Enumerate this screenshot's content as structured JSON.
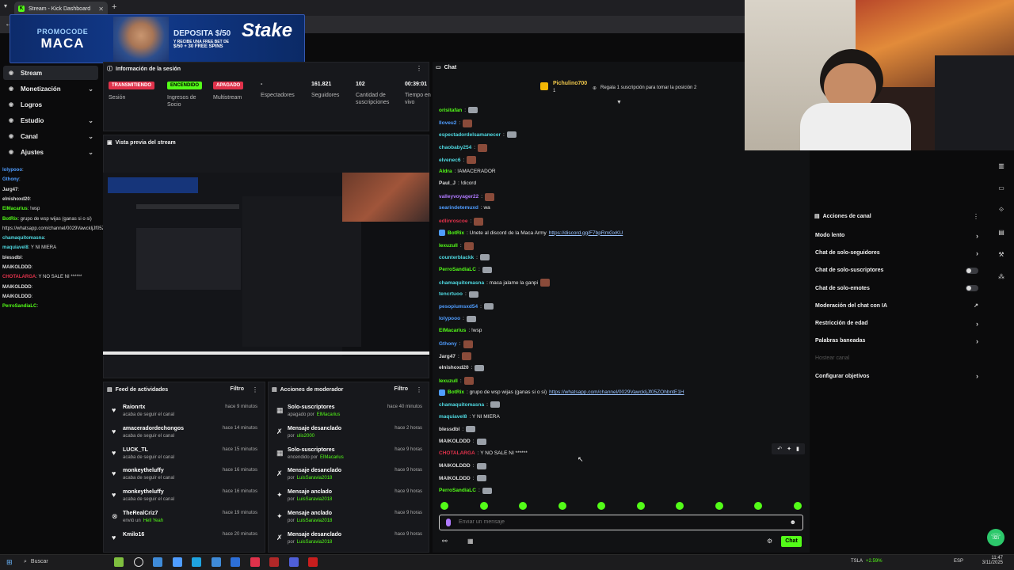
{
  "browser": {
    "tab_title": "Stream - Kick Dashboard"
  },
  "promo": {
    "line1": "PROMOCODE",
    "line2": "MACA",
    "deposit": "DEPOSITA $/50",
    "deposit_sub1": "Y RECIBE UNA FREE BET DE",
    "deposit_sub2": "$/50 + 30 FREE SPINS",
    "brand": "Stake"
  },
  "nav": {
    "items": [
      {
        "label": "Stream",
        "icon": "radio-icon"
      },
      {
        "label": "Monetización",
        "icon": "grid-icon"
      },
      {
        "label": "Logros",
        "icon": "trophy-icon"
      },
      {
        "label": "Estudio",
        "icon": "camera-icon"
      },
      {
        "label": "Canal",
        "icon": "display-icon"
      },
      {
        "label": "Ajustes",
        "icon": "gear-icon"
      }
    ]
  },
  "minichat": [
    {
      "user": "lolypooo",
      "text": ":",
      "color": "#4f9dff"
    },
    {
      "user": "Gthony",
      "text": ":",
      "color": "#4f9dff"
    },
    {
      "user": "Jarg47",
      "text": ":",
      "color": "#dddddd"
    },
    {
      "user": "elnishoxd20",
      "text": ":",
      "color": "#dddddd"
    },
    {
      "user": "ElMacarius",
      "text": ": !wsp",
      "color": "#53fc18"
    },
    {
      "user": "BotRix",
      "text": ": grupo de wsp wijas (ganas si o si)",
      "color": "#53fc18"
    },
    {
      "user": "",
      "text": "https://whatsapp.com/channel/0029VawckljJf05ZOhbntE1H",
      "color": "#dddddd"
    },
    {
      "user": "chamaquitomasna",
      "text": ":",
      "color": "#4fd8e0"
    },
    {
      "user": "maquiavel8",
      "text": ": Y NI MIERA",
      "color": "#4fd8e0"
    },
    {
      "user": "blessdbl",
      "text": ":",
      "color": "#dddddd"
    },
    {
      "user": "MAIKOLDDD",
      "text": ":",
      "color": "#dddddd"
    },
    {
      "user": "CHOTALARGA",
      "text": ": Y NO SALE NI ******",
      "color": "#e0324b"
    },
    {
      "user": "MAIKOLDDD",
      "text": ":",
      "color": "#dddddd"
    },
    {
      "user": "MAIKOLDDD",
      "text": ":",
      "color": "#dddddd"
    },
    {
      "user": "PerroSandiaLC",
      "text": ":",
      "color": "#53fc18"
    }
  ],
  "session": {
    "title": "Información de la sesión",
    "stats": [
      {
        "value": "TRANSMITIENDO",
        "label": "Sesión",
        "pill": "#e0324b"
      },
      {
        "value": "ENCENDIDO",
        "label": "Ingresos de Socio",
        "pill": "#53fc18"
      },
      {
        "value": "APAGADO",
        "label": "Multistream",
        "pill": "#e0324b"
      },
      {
        "value": "-",
        "label": "Espectadores"
      },
      {
        "value": "161.821",
        "label": "Seguidores"
      },
      {
        "value": "102",
        "label": "Cantidad de suscripciones"
      },
      {
        "value": "00:39:01",
        "label": "Tiempo en vivo"
      }
    ]
  },
  "preview": {
    "title": "Vista previa del stream"
  },
  "feed": {
    "title": "Feed de actividades",
    "filter": "Filtro",
    "items": [
      {
        "name": "Raionrtx",
        "sub": "acaba de seguir el canal",
        "time": "hace 9 minutos",
        "icon": "heart-icon"
      },
      {
        "name": "amaceradordechongos",
        "sub": "acaba de seguir el canal",
        "time": "hace 14 minutos",
        "icon": "heart-icon"
      },
      {
        "name": "LUCK_TL",
        "sub": "acaba de seguir el canal",
        "time": "hace 15 minutos",
        "icon": "heart-icon"
      },
      {
        "name": "monkeytheluffy",
        "sub": "acaba de seguir el canal",
        "time": "hace 16 minutos",
        "icon": "heart-icon"
      },
      {
        "name": "monkeytheluffy",
        "sub": "acaba de seguir el canal",
        "time": "hace 16 minutos",
        "icon": "heart-icon"
      },
      {
        "name": "TheRealCriz7",
        "sub": "envió un",
        "sub_hl": "Hell Yeah",
        "time": "hace 19 minutos",
        "icon": "kick-icon"
      },
      {
        "name": "Kmilo16",
        "sub": "",
        "time": "hace 20 minutos",
        "icon": "heart-icon"
      }
    ]
  },
  "mod": {
    "title": "Acciones de moderador",
    "filter": "Filtro",
    "items": [
      {
        "name": "Solo-suscriptores",
        "sub": "apagado por",
        "sub_hl": "ElMacarius",
        "time": "hace 40 minutos",
        "icon": "grid-icon"
      },
      {
        "name": "Mensaje desanclado",
        "sub": "por",
        "sub_hl": "ulis2000",
        "time": "hace 2 horas",
        "icon": "unpin-icon"
      },
      {
        "name": "Solo-suscriptores",
        "sub": "encendido por",
        "sub_hl": "ElMacarius",
        "time": "hace 9 horas",
        "icon": "grid-icon"
      },
      {
        "name": "Mensaje desanclado",
        "sub": "por",
        "sub_hl": "LuisSaravia2018",
        "time": "hace 9 horas",
        "icon": "unpin-icon"
      },
      {
        "name": "Mensaje anclado",
        "sub": "por",
        "sub_hl": "LuisSaravia2018",
        "time": "hace 9 horas",
        "icon": "pin-icon"
      },
      {
        "name": "Mensaje anclado",
        "sub": "por",
        "sub_hl": "LuisSaravia2018",
        "time": "hace 9 horas",
        "icon": "pin-icon"
      },
      {
        "name": "Mensaje desanclado",
        "sub": "por",
        "sub_hl": "LuisSaravia2018",
        "time": "hace 9 horas",
        "icon": "unpin-icon"
      }
    ]
  },
  "chat": {
    "title": "Chat",
    "top_user": "Pichulino700",
    "top_user_sub": "1",
    "gift_text": "Regala 1 suscripción para tomar la posición 2",
    "messages": [
      {
        "user": "orisitafan",
        "text": ":",
        "color": "#53fc18",
        "emote": "gray"
      },
      {
        "user": "lloveu2",
        "text": ":",
        "color": "#4f9dff",
        "emote": "red"
      },
      {
        "user": "espectadordelsamanecer",
        "text": ":",
        "color": "#4fd8e0",
        "emote": "gray"
      },
      {
        "user": "chaobaby254",
        "text": ":",
        "color": "#4fd8e0",
        "emote": "red"
      },
      {
        "user": "elvenec6",
        "text": ":",
        "color": "#4fd8e0",
        "emote": "red"
      },
      {
        "user": "Aldra",
        "text": ": !AMACERADOR",
        "color": "#53fc18"
      },
      {
        "user": "Paul_J",
        "text": ": !dicord",
        "color": "#dddddd"
      },
      {
        "user": "valleyvoyager22",
        "text": ":",
        "color": "#b07aff",
        "emote": "red"
      },
      {
        "user": "searindetemuxd",
        "text": ": wa",
        "color": "#4f9dff"
      },
      {
        "user": "edlinroscoe",
        "text": ":",
        "color": "#e0324b",
        "emote": "red"
      },
      {
        "user": "BotRix",
        "text": ": Unete al discord de la Maca Army",
        "link": "https://discord.gg/F7bpRmGxKU",
        "color": "#53fc18"
      },
      {
        "user": "lexuzull",
        "text": ":",
        "color": "#53fc18",
        "emote": "red"
      },
      {
        "user": "counterblackk",
        "text": ":",
        "color": "#4fd8e0",
        "emote": "gray"
      },
      {
        "user": "PerroSandiaLC",
        "text": ":",
        "color": "#53fc18",
        "emote": "gray"
      },
      {
        "user": "chamaquitomasna",
        "text": ": maca jalame la ganpi",
        "color": "#4fd8e0",
        "emote": "red"
      },
      {
        "user": "tencrtuoo",
        "text": ":",
        "color": "#4fd8e0",
        "emote": "gray"
      },
      {
        "user": "pesopiumsxd54",
        "text": ":",
        "color": "#4f9dff",
        "emote": "gray"
      },
      {
        "user": "lolypooo",
        "text": ":",
        "color": "#4f9dff",
        "emote": "gray"
      },
      {
        "user": "ElMacarius",
        "text": ": !wsp",
        "color": "#53fc18"
      },
      {
        "user": "Gthony",
        "text": ":",
        "color": "#4f9dff",
        "emote": "red"
      },
      {
        "user": "Jarg47",
        "text": ":",
        "color": "#dddddd",
        "emote": "red"
      },
      {
        "user": "elnishoxd20",
        "text": ":",
        "color": "#dddddd",
        "emote": "gray"
      },
      {
        "user": "lexuzull",
        "text": ":",
        "color": "#53fc18",
        "emote": "red"
      },
      {
        "user": "BotRix",
        "text": ": grupo de wsp wijas (ganas si o si)",
        "link": "https://whatsapp.com/channel/0029VawckljJf05ZOhbntE1H",
        "color": "#53fc18"
      },
      {
        "user": "chamaquitomasna",
        "text": ":",
        "color": "#4fd8e0",
        "emote": "gray"
      },
      {
        "user": "maquiavel8",
        "text": ": Y NI MIERA",
        "color": "#4fd8e0"
      },
      {
        "user": "blessdbl",
        "text": ":",
        "color": "#dddddd",
        "emote": "gray"
      },
      {
        "user": "MAIKOLDDD",
        "text": ":",
        "color": "#dddddd",
        "emote": "gray"
      },
      {
        "user": "CHOTALARGA",
        "text": ": Y NO SALE NI ******",
        "color": "#e0324b"
      },
      {
        "user": "MAIKOLDDD",
        "text": ":",
        "color": "#dddddd",
        "emote": "gray"
      },
      {
        "user": "MAIKOLDDD",
        "text": ":",
        "color": "#dddddd",
        "emote": "gray"
      },
      {
        "user": "PerroSandiaLC",
        "text": ":",
        "color": "#53fc18",
        "emote": "gray"
      }
    ],
    "input_placeholder": "Enviar un mensaje",
    "send_label": "Chat"
  },
  "actions": {
    "title": "Acciones de canal",
    "items": [
      {
        "label": "Modo lento",
        "control": "chevron"
      },
      {
        "label": "Chat de solo-seguidores",
        "control": "chevron"
      },
      {
        "label": "Chat de solo-suscriptores",
        "control": "toggle"
      },
      {
        "label": "Chat de solo-emotes",
        "control": "toggle"
      },
      {
        "label": "Moderación del chat con IA",
        "control": "external"
      },
      {
        "label": "Restricción de edad",
        "control": "chevron"
      },
      {
        "label": "Palabras baneadas",
        "control": "chevron"
      },
      {
        "label": "Hostear canal",
        "control": "none",
        "disabled": true
      },
      {
        "label": "Configurar objetivos",
        "control": "chevron"
      }
    ]
  },
  "taskbar": {
    "search": "Buscar",
    "ticker": "TSLA",
    "ticker_change": "+2.59%",
    "lang": "ESP",
    "time": "11:47",
    "date": "3/11/2025"
  },
  "colors": {
    "kick_green": "#53fc18",
    "live_red": "#e0324b",
    "panel": "#17181c"
  }
}
